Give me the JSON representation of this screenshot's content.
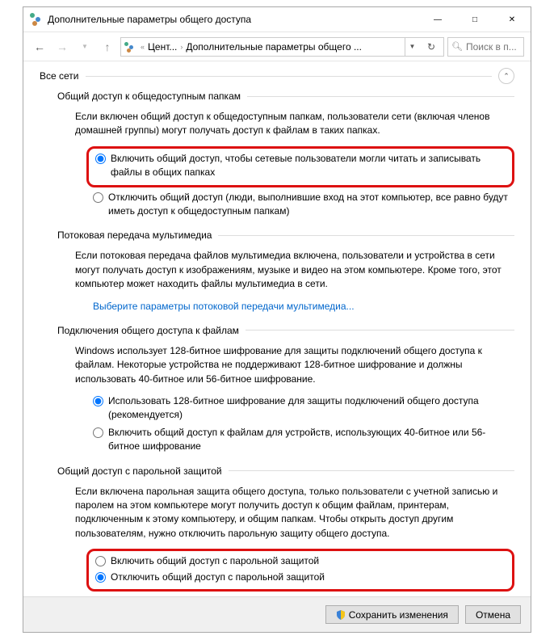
{
  "window": {
    "title": "Дополнительные параметры общего доступа"
  },
  "nav": {
    "crumb1": "Цент...",
    "crumb2": "Дополнительные параметры общего ...",
    "search_placeholder": "Поиск в п..."
  },
  "profile": {
    "name": "Все сети"
  },
  "sections": {
    "public_folders": {
      "title": "Общий доступ к общедоступным папкам",
      "description": "Если включен общий доступ к общедоступным папкам, пользователи сети (включая членов домашней группы) могут получать доступ к файлам в таких папках.",
      "opt1": "Включить общий доступ, чтобы сетевые пользователи могли читать и записывать файлы в общих папках",
      "opt2": "Отключить общий доступ (люди, выполнившие вход на этот компьютер, все равно будут иметь доступ к общедоступным папкам)"
    },
    "media": {
      "title": "Потоковая передача мультимедиа",
      "description": "Если потоковая передача файлов мультимедиа включена, пользователи и устройства в сети могут получать доступ к изображениям, музыке и видео на этом компьютере. Кроме того, этот компьютер может находить файлы мультимедиа в сети.",
      "link": "Выберите параметры потоковой передачи мультимедиа..."
    },
    "encryption": {
      "title": "Подключения общего доступа к файлам",
      "description": "Windows использует 128-битное шифрование для защиты подключений общего доступа к файлам. Некоторые устройства не поддерживают 128-битное шифрование и должны использовать 40-битное или 56-битное шифрование.",
      "opt1": "Использовать 128-битное шифрование для защиты подключений общего доступа (рекомендуется)",
      "opt2": "Включить общий доступ к файлам для устройств, использующих 40-битное или 56-битное шифрование"
    },
    "password": {
      "title": "Общий доступ с парольной защитой",
      "description": "Если включена парольная защита общего доступа, только пользователи с учетной записью и паролем на этом компьютере могут получить доступ к общим файлам, принтерам, подключенным к этому компьютеру, и общим папкам. Чтобы открыть доступ другим пользователям, нужно отключить парольную защиту общего доступа.",
      "opt1": "Включить общий доступ с парольной защитой",
      "opt2": "Отключить общий доступ с парольной защитой"
    }
  },
  "footer": {
    "save": "Сохранить изменения",
    "cancel": "Отмена"
  }
}
